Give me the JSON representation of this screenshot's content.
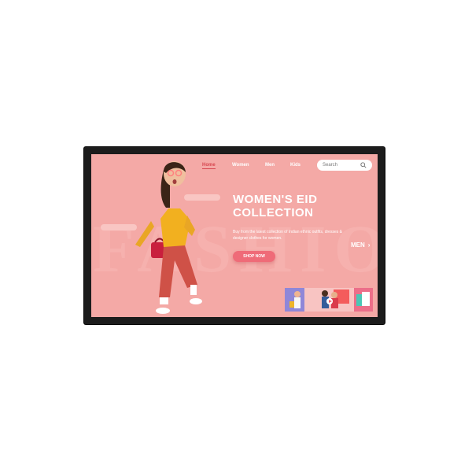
{
  "nav": {
    "items": [
      {
        "label": "Home",
        "active": true
      },
      {
        "label": "Women",
        "active": false
      },
      {
        "label": "Men",
        "active": false
      },
      {
        "label": "Kids",
        "active": false
      }
    ]
  },
  "search": {
    "placeholder": "Search"
  },
  "hero": {
    "title_line1": "WOMEN'S EID",
    "title_line2": "COLLECTION",
    "description": "Buy from the latest collection of Indian ethnic outfits, dresses & designer clothes for women.",
    "cta_label": "SHOP NOW",
    "next_label": "MEN",
    "background_word": "FASHION"
  },
  "thumbnails": [
    {
      "name": "thumb-shopping"
    },
    {
      "name": "thumb-couple"
    },
    {
      "name": "thumb-gifts"
    }
  ],
  "colors": {
    "background": "#f4a9a6",
    "accent": "#d7464f",
    "button": "#ef6b78",
    "bezel": "#1c1c1c"
  }
}
